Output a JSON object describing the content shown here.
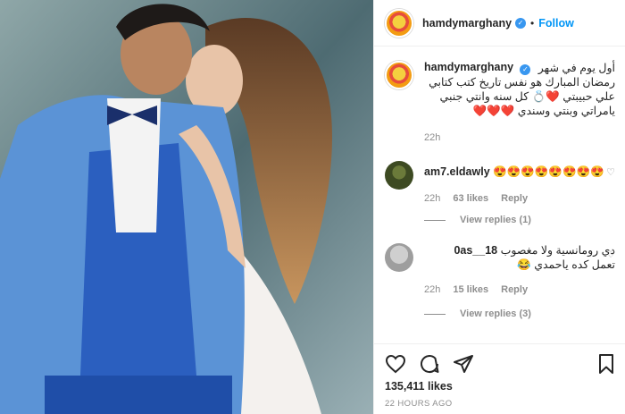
{
  "post": {
    "username": "hamdymarghany",
    "follow_label": "Follow",
    "dot": "•",
    "verified_glyph": "✓"
  },
  "caption": {
    "username": "hamdymarghany",
    "lines": [
      "أول يوم في شهر",
      "رمضان المبارك هو نفس تاريخ كتب كتابي",
      "علي حبيبتي ❤️💍 كل سنه وانتي جنبي",
      "يامراتي وبنتي وسندي ❤️❤️❤️"
    ],
    "time": "22h"
  },
  "comments": [
    {
      "username": "am7.eldawly",
      "text": "😍😍😍😍😍😍😍😍",
      "time": "22h",
      "likes": "63 likes",
      "reply": "Reply",
      "view_replies": "View replies (1)"
    },
    {
      "username": "0as__18",
      "text_line1": "دي رومانسية ولا مغصوب",
      "text_line2": "تعمل كده ياحمدي 😂",
      "time": "22h",
      "likes": "15 likes",
      "reply": "Reply",
      "view_replies": "View replies (3)"
    }
  ],
  "actions": {
    "likes_count": "135,411 likes",
    "posted_ago": "22 HOURS AGO"
  },
  "icons": [
    "heart-icon",
    "comment-icon",
    "share-icon",
    "bookmark-icon",
    "verified-icon"
  ],
  "colors": {
    "accent": "#0095f6",
    "verified": "#3897f0",
    "muted": "#8e8e8e"
  }
}
